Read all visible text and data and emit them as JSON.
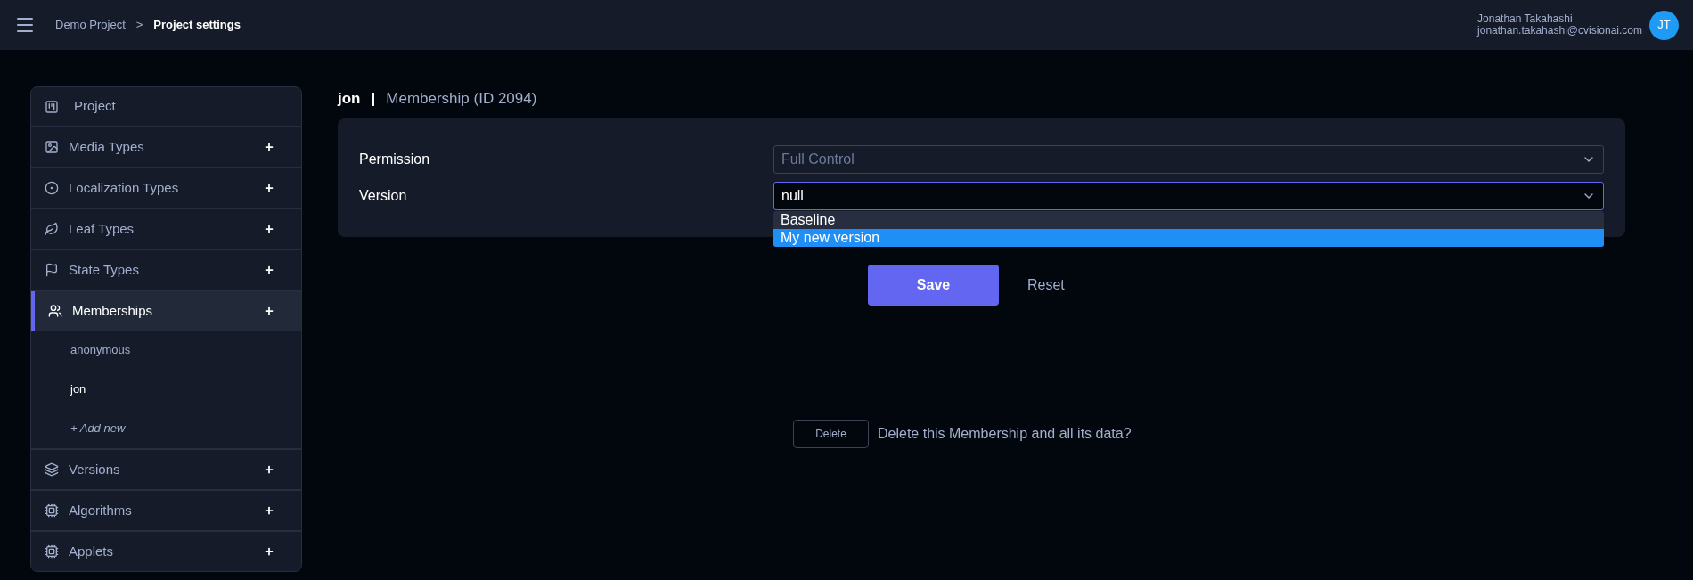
{
  "header": {
    "breadcrumb": [
      {
        "label": "Demo Project",
        "current": false
      },
      {
        "label": "Project settings",
        "current": true
      }
    ],
    "separator": ">",
    "user": {
      "name": "Jonathan Takahashi",
      "email": "jonathan.takahashi@cvisionai.com",
      "initials": "JT"
    }
  },
  "sidebar": {
    "items": [
      {
        "label": "Project",
        "addable": false,
        "selected": false
      },
      {
        "label": "Media Types",
        "addable": true,
        "selected": false
      },
      {
        "label": "Localization Types",
        "addable": true,
        "selected": false
      },
      {
        "label": "Leaf Types",
        "addable": true,
        "selected": false
      },
      {
        "label": "State Types",
        "addable": true,
        "selected": false
      },
      {
        "label": "Memberships",
        "addable": true,
        "selected": true,
        "children": [
          {
            "label": "anonymous",
            "kind": "entry",
            "selected": false
          },
          {
            "label": "jon",
            "kind": "entry",
            "selected": true
          },
          {
            "label": "+ Add new",
            "kind": "add"
          }
        ]
      },
      {
        "label": "Versions",
        "addable": true,
        "selected": false
      },
      {
        "label": "Algorithms",
        "addable": true,
        "selected": false
      },
      {
        "label": "Applets",
        "addable": true,
        "selected": false
      }
    ]
  },
  "main": {
    "title": "jon",
    "separator": "|",
    "subtitle": "Membership (ID 2094)",
    "fields": [
      {
        "label": "Permission",
        "value": "Full Control",
        "disabled": true,
        "focused": false
      },
      {
        "label": "Version",
        "value": "null",
        "disabled": false,
        "focused": true,
        "options": [
          {
            "label": "Baseline",
            "selected": false
          },
          {
            "label": "My new version",
            "selected": true
          }
        ]
      }
    ],
    "save": "Save",
    "reset": "Reset",
    "delete": {
      "button": "Delete",
      "prompt": "Delete this Membership and all its data?"
    }
  }
}
